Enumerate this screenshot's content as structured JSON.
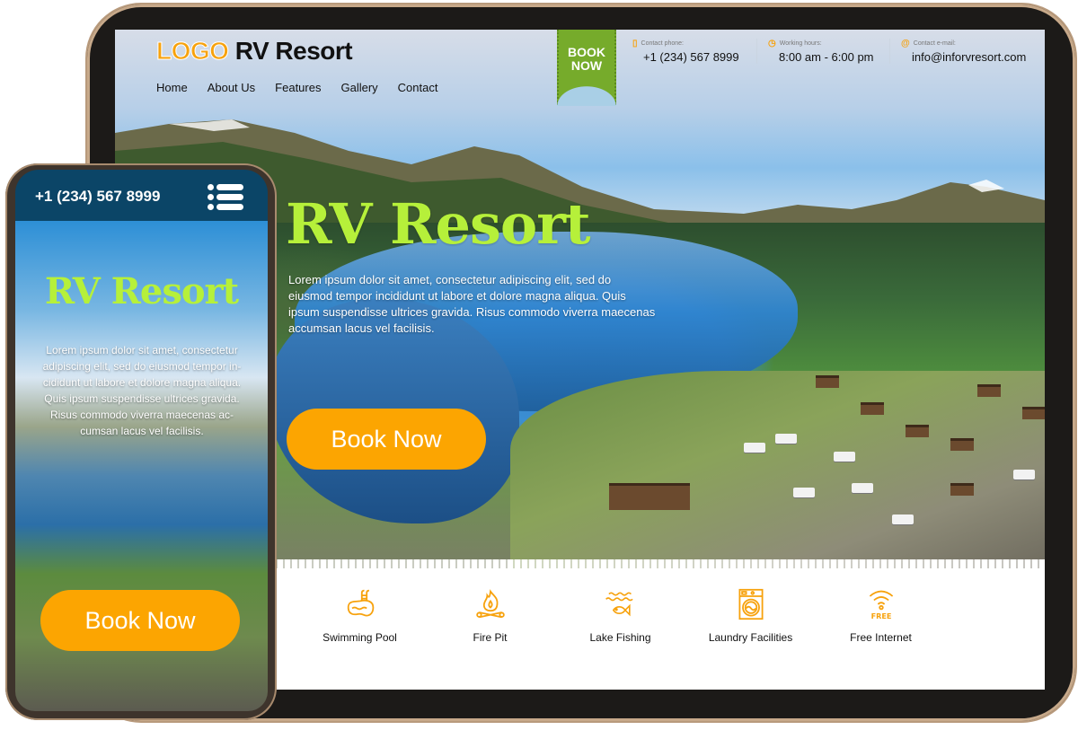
{
  "tablet": {
    "logo": {
      "mark": "LOGO",
      "name": "RV Resort"
    },
    "nav": [
      {
        "label": "Home"
      },
      {
        "label": "About Us"
      },
      {
        "label": "Features"
      },
      {
        "label": "Gallery"
      },
      {
        "label": "Contact"
      }
    ],
    "ribbon": {
      "line1": "BOOK",
      "line2": "NOW"
    },
    "contacts": [
      {
        "icon": "phone-icon",
        "label": "Contact phone:",
        "value": "+1 (234) 567 8999"
      },
      {
        "icon": "clock-icon",
        "label": "Working hours:",
        "value": "8:00 am - 6:00 pm"
      },
      {
        "icon": "at-icon",
        "label": "Contact e-mail:",
        "value": "info@inforvresort.com"
      }
    ],
    "hero": {
      "title": "RV Resort",
      "text": "Lorem ipsum dolor sit amet, consectetur adipiscing elit, sed do eiusmod tempor incididunt ut labore et dolore magna aliqua. Quis ipsum suspendisse ultrices gravida. Risus commodo viverra maecenas accumsan lacus vel facilisis.",
      "button": "Book Now"
    },
    "features": [
      {
        "icon": "swimming-pool-icon",
        "label": "Swimming Pool"
      },
      {
        "icon": "fire-pit-icon",
        "label": "Fire Pit"
      },
      {
        "icon": "lake-fishing-icon",
        "label": "Lake Fishing"
      },
      {
        "icon": "laundry-icon",
        "label": "Laundry Facilities"
      },
      {
        "icon": "free-wifi-icon",
        "label": "Free Internet",
        "badge": "FREE"
      }
    ]
  },
  "phone": {
    "phone_number": "+1 (234) 567 8999",
    "title": "RV Resort",
    "text": "Lorem ipsum dolor sit amet, consectetur adipiscing elit, sed do eiusmod tempor in-cididunt ut labore et dolore magna aliqua. Quis ipsum suspendisse ultrices gravida. Risus commodo viverra maecenas ac-cumsan lacus vel facilisis.",
    "button": "Book Now"
  },
  "colors": {
    "accent_orange": "#fca501",
    "title_green": "#b6f03a",
    "ribbon_green": "#76ab2b",
    "phone_header": "#0b4567"
  }
}
